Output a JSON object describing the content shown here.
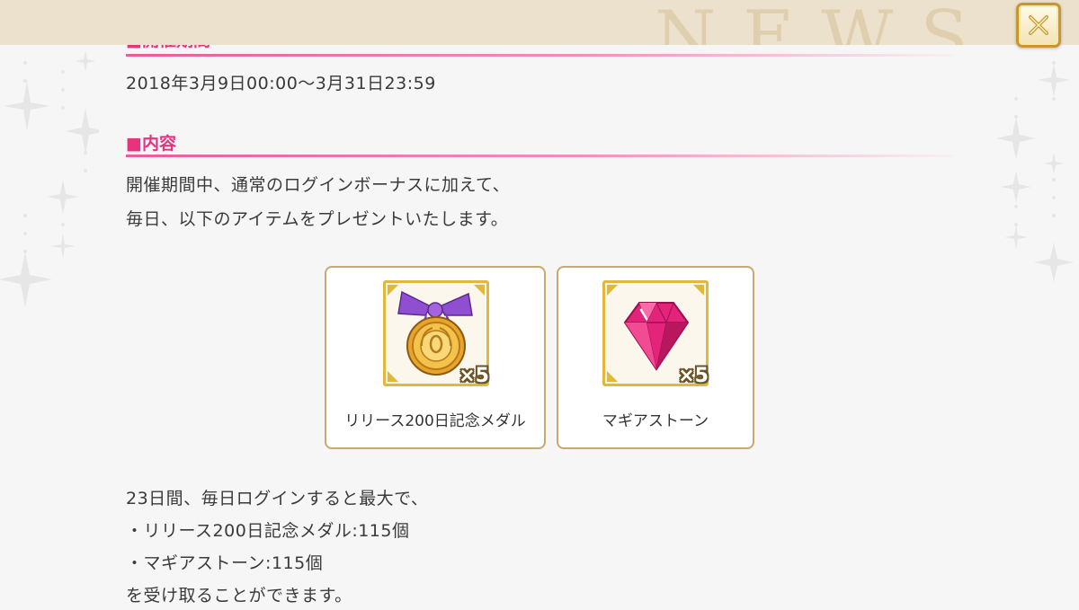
{
  "header": {
    "watermark": "NEWS",
    "close_label": "×"
  },
  "sections": {
    "period_heading": "■開催期間",
    "period_text": "2018年3月9日00:00～3月31日23:59",
    "content_heading": "■内容",
    "content_lines": [
      "開催期間中、通常のログインボーナスに加えて、",
      "毎日、以下のアイテムをプレゼントいたします。"
    ]
  },
  "items": [
    {
      "name": "リリース200日記念メダル",
      "quantity": "×5",
      "icon": "medal-icon"
    },
    {
      "name": "マギアストーン",
      "quantity": "×5",
      "icon": "gem-icon"
    }
  ],
  "summary_lines": [
    "23日間、毎日ログインすると最大で、",
    "・リリース200日記念メダル:115個",
    "・マギアストーン:115個",
    "を受け取ることができます。"
  ],
  "colors": {
    "heading": "#e5337f",
    "rule": "#e85d9c",
    "header_bar": "#ece1cc",
    "card_border": "#c8a96e",
    "item_frame": "#e2b73a"
  }
}
